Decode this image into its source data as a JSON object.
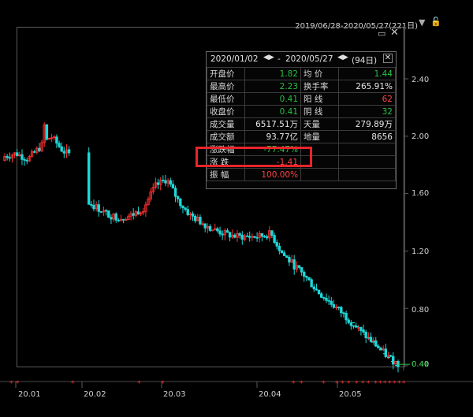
{
  "header": {
    "date_range": "2019/06/28-2020/05/27(221日)",
    "dropdown_icon": "triangle-down-icon",
    "lock_icon": "lock-icon"
  },
  "window_controls": {
    "restore": "restore-icon",
    "close": "close-icon"
  },
  "y_axis": {
    "ticks": [
      "2.40",
      "2.00",
      "1.60",
      "1.20",
      "0.80",
      "0.40"
    ]
  },
  "x_axis": {
    "ticks": [
      "20.01",
      "20.02",
      "20.03",
      "20.04",
      "20.05"
    ]
  },
  "last_price_label": "0.41",
  "stats_panel": {
    "start_date": "2020/01/02",
    "sep": "-",
    "end_date": "2020/05/27",
    "days": "(94日)",
    "rows": [
      {
        "k1": "开盘价",
        "v1": "1.82",
        "k2": "均  价",
        "v2": "1.44"
      },
      {
        "k1": "最高价",
        "v1": "2.23",
        "k2": "换手率",
        "v2": "265.91%"
      },
      {
        "k1": "最低价",
        "v1": "0.41",
        "k2": "阳  线",
        "v2": "62"
      },
      {
        "k1": "收盘价",
        "v1": "0.41",
        "k2": "阴  线",
        "v2": "32"
      },
      {
        "k1": "成交量",
        "v1": "6517.51万",
        "k2": "天量",
        "v2": "279.89万"
      },
      {
        "k1": "成交额",
        "v1": "93.77亿",
        "k2": "地量",
        "v2": "8656"
      },
      {
        "k1": "涨跌幅",
        "v1": "-77.47%",
        "k2": "",
        "v2": ""
      },
      {
        "k1": "涨  跌",
        "v1": "-1.41",
        "k2": "",
        "v2": ""
      },
      {
        "k1": "振  幅",
        "v1": "100.00%",
        "k2": "",
        "v2": ""
      }
    ]
  },
  "chart_data": {
    "type": "candlestick",
    "ylim": [
      0.4,
      2.4
    ],
    "x_ticks": [
      "20.01",
      "20.02",
      "20.03",
      "20.04",
      "20.05"
    ],
    "closes_approx": [
      1.86,
      1.88,
      1.84,
      1.92,
      2.0,
      1.9,
      1.85,
      1.55,
      1.5,
      1.45,
      1.43,
      1.45,
      1.5,
      1.65,
      1.7,
      1.55,
      1.45,
      1.4,
      1.35,
      1.32,
      1.3,
      1.3,
      1.3,
      1.32,
      1.18,
      1.1,
      1.02,
      0.92,
      0.85,
      0.78,
      0.7,
      0.62,
      0.55,
      0.47,
      0.41
    ]
  },
  "colors": {
    "up": "#ff3030",
    "down": "#1fd7d7",
    "highlight": "#e8252a"
  }
}
